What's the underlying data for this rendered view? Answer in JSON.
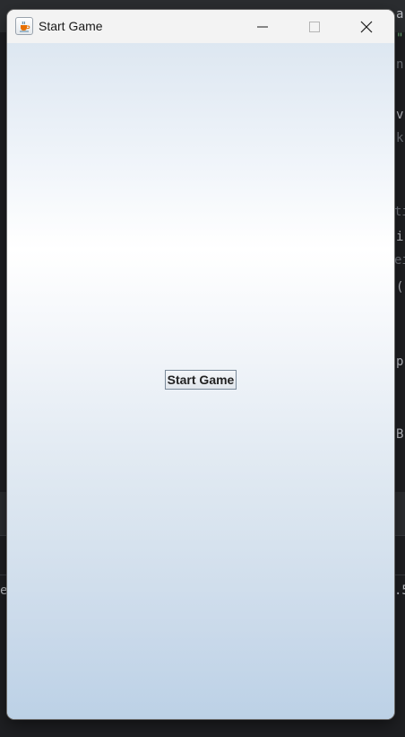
{
  "window": {
    "title": "Start Game",
    "controls": {
      "minimize": "minimize-icon",
      "maximize": "maximize-icon",
      "close": "close-icon"
    }
  },
  "main": {
    "start_button_label": "Start Game"
  },
  "background_fragments": [
    "a",
    "\"",
    "n",
    "v",
    "k",
    "ti",
    "i",
    "ei",
    "(",
    "p",
    "B",
    "e",
    ".5"
  ]
}
